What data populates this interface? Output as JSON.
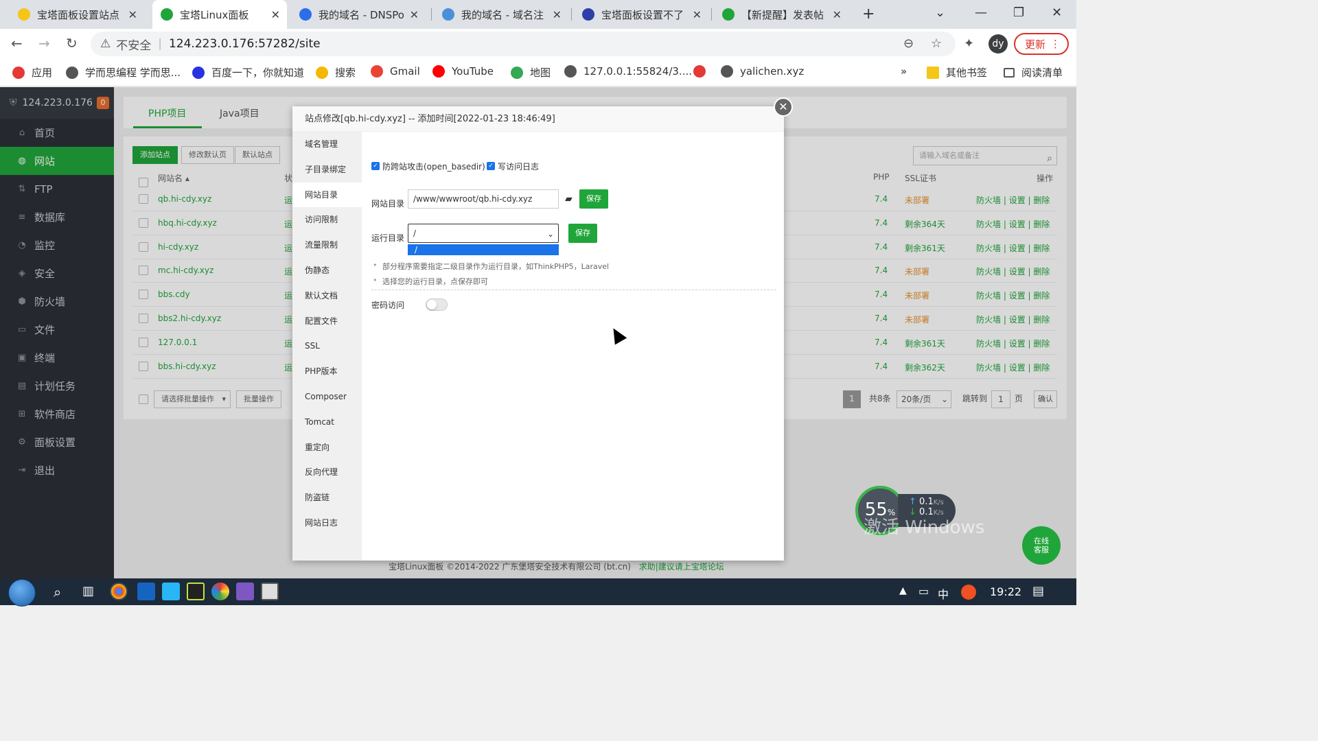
{
  "browser": {
    "tabs": [
      {
        "title": "宝塔面板设置站点",
        "color": "#f5c518"
      },
      {
        "title": "宝塔Linux面板",
        "color": "#20a53a"
      },
      {
        "title": "我的域名 - DNSPo",
        "color": "#2d6ee8"
      },
      {
        "title": "我的域名 - 域名注",
        "color": "#4a90d9"
      },
      {
        "title": "宝塔面板设置不了",
        "color": "#2c3ea8"
      },
      {
        "title": "【新提醒】发表帖",
        "color": "#20a53a"
      }
    ],
    "insecure_label": "不安全",
    "url": "124.223.0.176:57282/site",
    "avatar": "dy",
    "update_label": "更新",
    "bookmarks": [
      {
        "label": "应用",
        "color": "#e53935"
      },
      {
        "label": "学而思编程 学而思...",
        "color": "#555555"
      },
      {
        "label": "百度一下，你就知道",
        "color": "#2932e1"
      },
      {
        "label": "搜索",
        "color": "#f5b800"
      },
      {
        "label": "Gmail",
        "color": "#ea4335"
      },
      {
        "label": "YouTube",
        "color": "#ff0000"
      },
      {
        "label": "地图",
        "color": "#34a853"
      },
      {
        "label": "127.0.0.1:55824/3....",
        "color": "#555555"
      },
      {
        "label": "",
        "color": "#e53935"
      },
      {
        "label": "yalichen.xyz",
        "color": "#555555"
      }
    ],
    "bookmarks_more": "»",
    "other_bookmarks": "其他书签",
    "reading_list": "阅读清单"
  },
  "sidebar": {
    "server": "124.223.0.176",
    "badge": "0",
    "items": [
      {
        "label": "首页",
        "icon": "home-icon",
        "glyph": "⌂"
      },
      {
        "label": "网站",
        "icon": "globe-icon",
        "glyph": "◍"
      },
      {
        "label": "FTP",
        "icon": "ftp-icon",
        "glyph": "⇅"
      },
      {
        "label": "数据库",
        "icon": "database-icon",
        "glyph": "≡"
      },
      {
        "label": "监控",
        "icon": "monitor-icon",
        "glyph": "◔"
      },
      {
        "label": "安全",
        "icon": "shield-icon",
        "glyph": "◈"
      },
      {
        "label": "防火墙",
        "icon": "firewall-icon",
        "glyph": "⬢"
      },
      {
        "label": "文件",
        "icon": "folder-icon",
        "glyph": "▭"
      },
      {
        "label": "终端",
        "icon": "terminal-icon",
        "glyph": "▣"
      },
      {
        "label": "计划任务",
        "icon": "calendar-icon",
        "glyph": "▤"
      },
      {
        "label": "软件商店",
        "icon": "apps-icon",
        "glyph": "⊞"
      },
      {
        "label": "面板设置",
        "icon": "gear-icon",
        "glyph": "⚙"
      },
      {
        "label": "退出",
        "icon": "logout-icon",
        "glyph": "⇥"
      }
    ]
  },
  "main": {
    "tabs": [
      "PHP项目",
      "Java项目"
    ],
    "buttons": [
      "添加站点",
      "修改默认页",
      "默认站点"
    ],
    "search_placeholder": "请输入域名或备注",
    "columns": {
      "name": "网站名",
      "status": "状",
      "php": "PHP",
      "ssl": "SSL证书",
      "ops": "操作"
    },
    "rows": [
      {
        "name": "qb.hi-cdy.xyz",
        "status": "运",
        "php": "7.4",
        "ssl": "未部署",
        "ssl_ok": false
      },
      {
        "name": "hbq.hi-cdy.xyz",
        "status": "运",
        "php": "7.4",
        "ssl": "剩余364天",
        "ssl_ok": true
      },
      {
        "name": "hi-cdy.xyz",
        "status": "运",
        "php": "7.4",
        "ssl": "剩余361天",
        "ssl_ok": true
      },
      {
        "name": "mc.hi-cdy.xyz",
        "status": "运",
        "php": "7.4",
        "ssl": "未部署",
        "ssl_ok": false
      },
      {
        "name": "bbs.cdy",
        "status": "运",
        "php": "7.4",
        "ssl": "未部署",
        "ssl_ok": false
      },
      {
        "name": "bbs2.hi-cdy.xyz",
        "status": "运",
        "php": "7.4",
        "ssl": "未部署",
        "ssl_ok": false
      },
      {
        "name": "127.0.0.1",
        "status": "运",
        "php": "7.4",
        "ssl": "剩余361天",
        "ssl_ok": true
      },
      {
        "name": "bbs.hi-cdy.xyz",
        "status": "运",
        "php": "7.4",
        "ssl": "剩余362天",
        "ssl_ok": true
      }
    ],
    "row_ops": [
      "防火墙",
      "设置",
      "删除"
    ],
    "bulk_placeholder": "请选择批量操作",
    "bulk_button": "批量操作",
    "pager": {
      "page": "1",
      "total": "共8条",
      "per_page": "20条/页",
      "jump_label": "跳转到",
      "jump_value": "1",
      "page_unit": "页",
      "confirm": "确认"
    },
    "footer": "宝塔Linux面板 ©2014-2022 广东堡塔安全技术有限公司 (bt.cn)",
    "footer_link": "求助|建议请上宝塔论坛"
  },
  "dialog": {
    "title": "站点修改[qb.hi-cdy.xyz] -- 添加时间[2022-01-23 18:46:49]",
    "menu": [
      "域名管理",
      "子目录绑定",
      "网站目录",
      "访问限制",
      "流量限制",
      "伪静态",
      "默认文档",
      "配置文件",
      "SSL",
      "PHP版本",
      "Composer",
      "Tomcat",
      "重定向",
      "反向代理",
      "防盗链",
      "网站日志"
    ],
    "active_menu": 2,
    "anti_xss_label": "防跨站攻击(open_basedir)",
    "access_log_label": "写访问日志",
    "site_dir_label": "网站目录",
    "site_dir_value": "/www/wwwroot/qb.hi-cdy.xyz",
    "run_dir_label": "运行目录",
    "run_dir_value": "/",
    "run_dir_option": "/",
    "save_label": "保存",
    "tips": [
      "部分程序需要指定二级目录作为运行目录，如ThinkPHP5，Laravel",
      "选择您的运行目录，点保存即可"
    ],
    "password_label": "密码访问"
  },
  "widgets": {
    "cpu_percent": "55",
    "cpu_unit": "%",
    "up_speed": "0.1",
    "down_speed": "0.1",
    "speed_unit": "K/s",
    "watermark": "激活 Windows",
    "chat_line1": "在线",
    "chat_line2": "客服"
  },
  "taskbar": {
    "ime": "中",
    "time": "19:22"
  }
}
